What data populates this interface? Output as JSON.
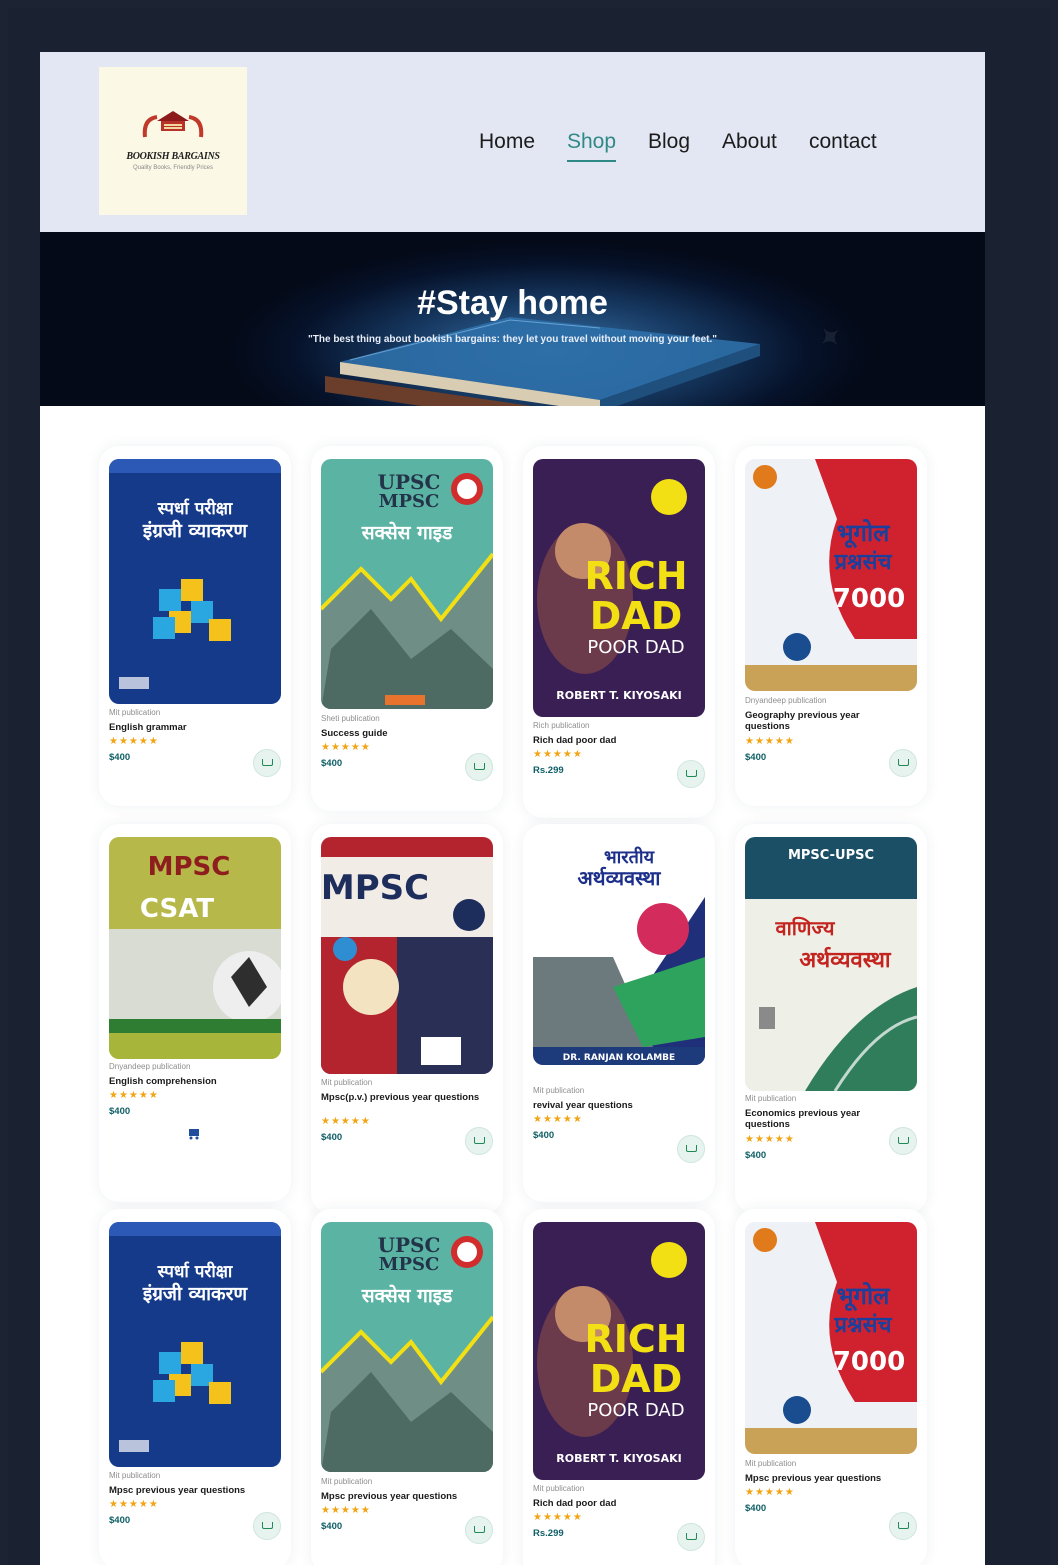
{
  "brand": {
    "name": "BOOKISH BARGAINS",
    "tagline": "Quality Books, Friendly Prices"
  },
  "nav": {
    "items": [
      "Home",
      "Shop",
      "Blog",
      "About",
      "contact"
    ],
    "active": "Shop"
  },
  "hero": {
    "title": "#Stay home",
    "subtitle": "\"The best thing about bookish bargains: they let you travel without moving your feet.\""
  },
  "colors": {
    "accent": "#2f8a86",
    "price": "#0f5f66",
    "star": "#f2a413",
    "header_bg": "#e3e6f3",
    "page_bg": "#1c2333"
  },
  "products": [
    {
      "publisher": "Mit publication",
      "title": "English grammar",
      "rating": "★★★★★",
      "price": "$400",
      "cover": "english-grammar"
    },
    {
      "publisher": "Sheti publication",
      "title": "Success guide",
      "rating": "★★★★★",
      "price": "$400",
      "cover": "success-guide"
    },
    {
      "publisher": "Rich publication",
      "title": "Rich dad poor dad",
      "rating": "★★★★★",
      "price": "Rs.299",
      "cover": "rich-dad"
    },
    {
      "publisher": "Dnyandeep publication",
      "title": "Geography previous year questions",
      "rating": "★★★★★",
      "price": "$400",
      "cover": "bhugol"
    },
    {
      "publisher": "Dnyandeep publication",
      "title": "English comprehension",
      "rating": "★★★★★",
      "price": "$400",
      "cover": "csat"
    },
    {
      "publisher": "Mit publication",
      "title": "Mpsc(p.v.) previous year questions",
      "rating": "★★★★★",
      "price": "$400",
      "cover": "mpsc"
    },
    {
      "publisher": "Mit publication",
      "title": "revival year questions",
      "rating": "★★★★★",
      "price": "$400",
      "cover": "arthvyavastha"
    },
    {
      "publisher": "Mit publication",
      "title": "Economics previous year questions",
      "rating": "★★★★★",
      "price": "$400",
      "cover": "mpsc-upsc"
    },
    {
      "publisher": "Mit publication",
      "title": "Mpsc previous year questions",
      "rating": "★★★★★",
      "price": "$400",
      "cover": "english-grammar"
    },
    {
      "publisher": "Mit publication",
      "title": "Mpsc previous year questions",
      "rating": "★★★★★",
      "price": "$400",
      "cover": "success-guide"
    },
    {
      "publisher": "Mit publication",
      "title": "Rich dad poor dad",
      "rating": "★★★★★",
      "price": "Rs.299",
      "cover": "rich-dad"
    },
    {
      "publisher": "Mit publication",
      "title": "Mpsc previous year questions",
      "rating": "★★★★★",
      "price": "$400",
      "cover": "bhugol"
    }
  ],
  "cover_text": {
    "english_grammar": {
      "top": "स्पर्धा परीक्षा",
      "main": "इंग्रजी व्याकरण"
    },
    "success_guide": {
      "line1": "UPSC",
      "line2": "MPSC",
      "main": "सक्सेस गाइड"
    },
    "rich_dad": {
      "line1": "RICH",
      "line2": "DAD",
      "line3": "POOR DAD",
      "author": "ROBERT T. KIYOSAKI"
    },
    "bhugol": {
      "line1": "भूगोल",
      "line2": "प्रश्नसंच",
      "num": "7000"
    },
    "csat": {
      "line1": "MPSC",
      "line2": "CSAT"
    },
    "mpsc": {
      "line1": "MPSC"
    },
    "arthvyavastha": {
      "line1": "भारतीय",
      "line2": "अर्थव्यवस्था",
      "author": "DR. RANJAN KOLAMBE"
    },
    "mpsc_upsc": {
      "line1": "MPSC-UPSC",
      "line2": "वाणिज्य",
      "line3": "अर्थव्यवस्था"
    }
  }
}
